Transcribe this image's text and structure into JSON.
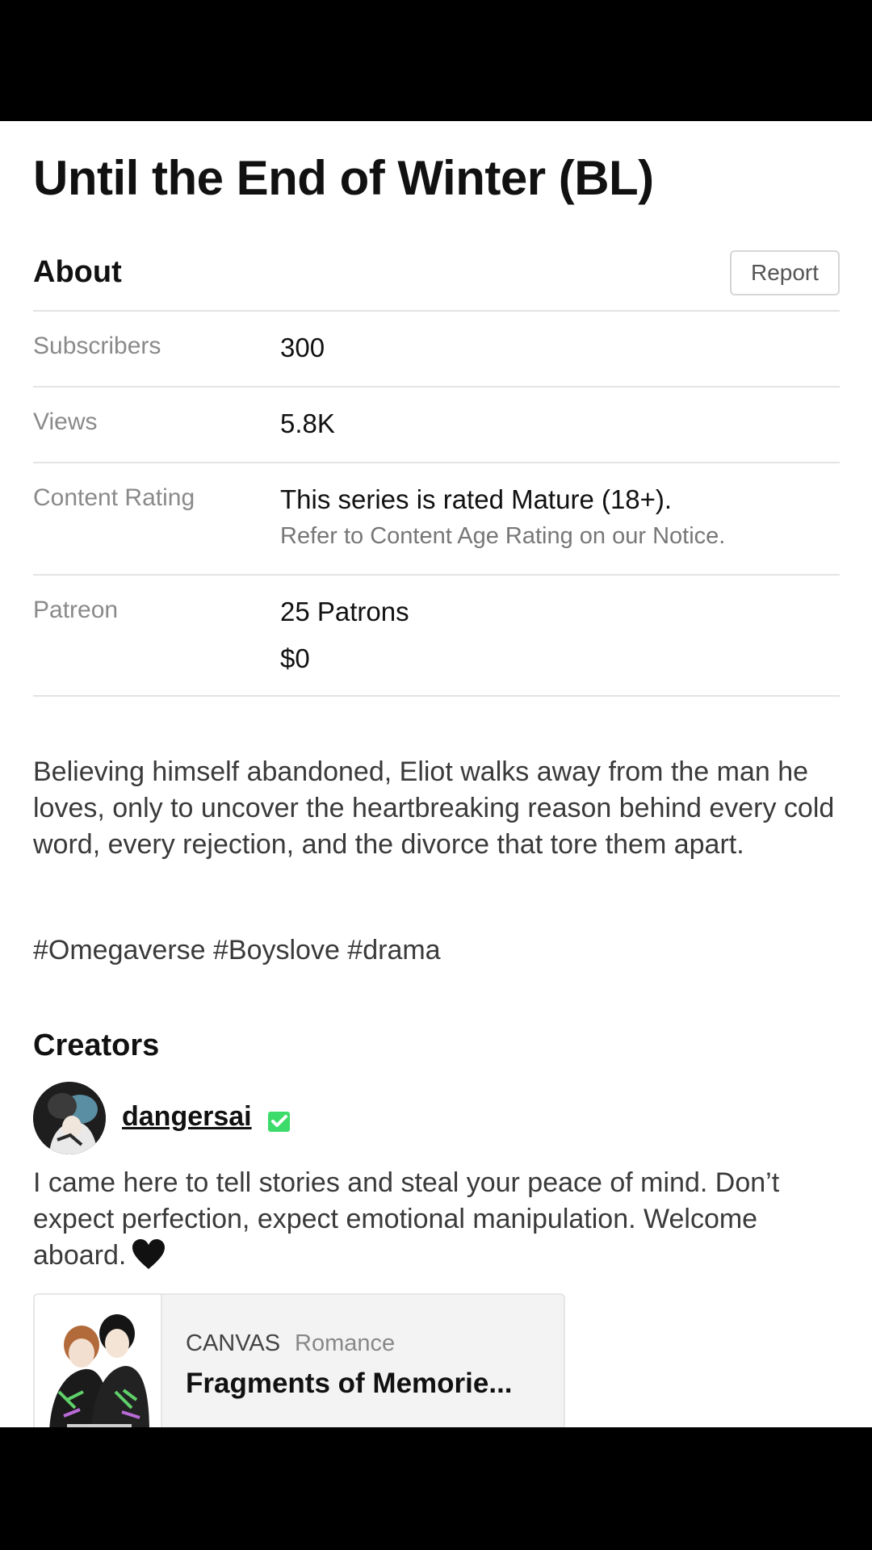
{
  "series": {
    "title": "Until the End of Winter (BL)"
  },
  "about": {
    "heading": "About",
    "report_label": "Report",
    "rows": [
      {
        "label": "Subscribers",
        "value": "300"
      },
      {
        "label": "Views",
        "value": "5.8K"
      },
      {
        "label": "Content Rating",
        "value": "This series is rated Mature (18+).",
        "sub": "Refer to Content Age Rating on our Notice."
      },
      {
        "label": "Patreon",
        "value": "25 Patrons",
        "value2": "$0"
      }
    ]
  },
  "description": "Believing himself abandoned, Eliot walks away from the man he loves, only to uncover the heartbreaking reason behind every cold word, every rejection, and the divorce that tore them apart.",
  "tags": "#Omegaverse #Boyslove #drama",
  "creators": {
    "heading": "Creators",
    "name": "dangersai",
    "verified_icon": "verified-check-icon",
    "verified_color": "#3ddc6a",
    "bio": "I came here to tell stories and steal your peace of mind. Don’t expect perfection, expect emotional manipulation. Welcome aboard.",
    "bio_icon": "black-heart-icon"
  },
  "related_card": {
    "tag": "CANVAS",
    "genre": "Romance",
    "title": "Fragments of Memorie..."
  }
}
